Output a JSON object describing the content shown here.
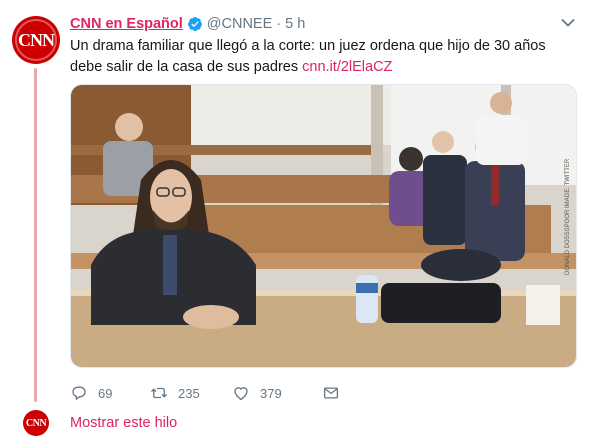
{
  "account": {
    "display_name": "CNN en Español",
    "handle": "@CNNEE",
    "separator": "·",
    "time": "5 h",
    "avatar_text": "CNN",
    "verified": true
  },
  "tweet": {
    "text": "Un drama familiar que llegó a la corte: un juez ordena que hijo de 30 años debe salir de la casa de sus padres ",
    "link": "cnn.it/2lElaCZ"
  },
  "media": {
    "icon": "photo",
    "watermark": "DONALD DOSSSPOOR IMAGE: TWITTER"
  },
  "actions": {
    "reply": {
      "icon": "reply-icon",
      "count": "69"
    },
    "retweet": {
      "icon": "retweet-icon",
      "count": "235"
    },
    "like": {
      "icon": "heart-icon",
      "count": "379"
    },
    "dm": {
      "icon": "envelope-icon"
    }
  },
  "thread": {
    "show_thread_label": "Mostrar este hilo"
  },
  "colors": {
    "brand": "#cc0000",
    "accent": "#e0245e",
    "thread_line": "#e8a7ad",
    "muted": "#657786"
  }
}
